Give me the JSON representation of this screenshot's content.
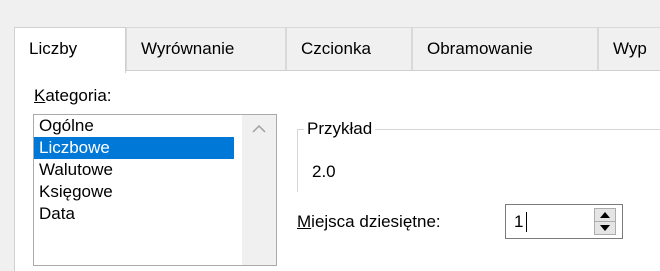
{
  "tabs": [
    {
      "label": "Liczby",
      "active": true
    },
    {
      "label": "Wyrównanie",
      "active": false
    },
    {
      "label": "Czcionka",
      "active": false
    },
    {
      "label": "Obramowanie",
      "active": false
    },
    {
      "label": "Wyp",
      "active": false
    }
  ],
  "category": {
    "label_first": "K",
    "label_rest": "ategoria:",
    "items": [
      "Ogólne",
      "Liczbowe",
      "Walutowe",
      "Księgowe",
      "Data"
    ],
    "selected": "Liczbowe"
  },
  "sample": {
    "legend": "Przykład",
    "value": "2.0"
  },
  "decimals": {
    "label_first": "M",
    "label_rest": "iejsca dziesiętne:",
    "value": "1"
  },
  "icons": {
    "scroll_up": "chevron-up-icon",
    "spin_up": "triangle-up-icon",
    "spin_down": "triangle-down-icon"
  },
  "colors": {
    "selection": "#0078d7",
    "background": "#f0f0f0",
    "panel": "#ffffff"
  }
}
